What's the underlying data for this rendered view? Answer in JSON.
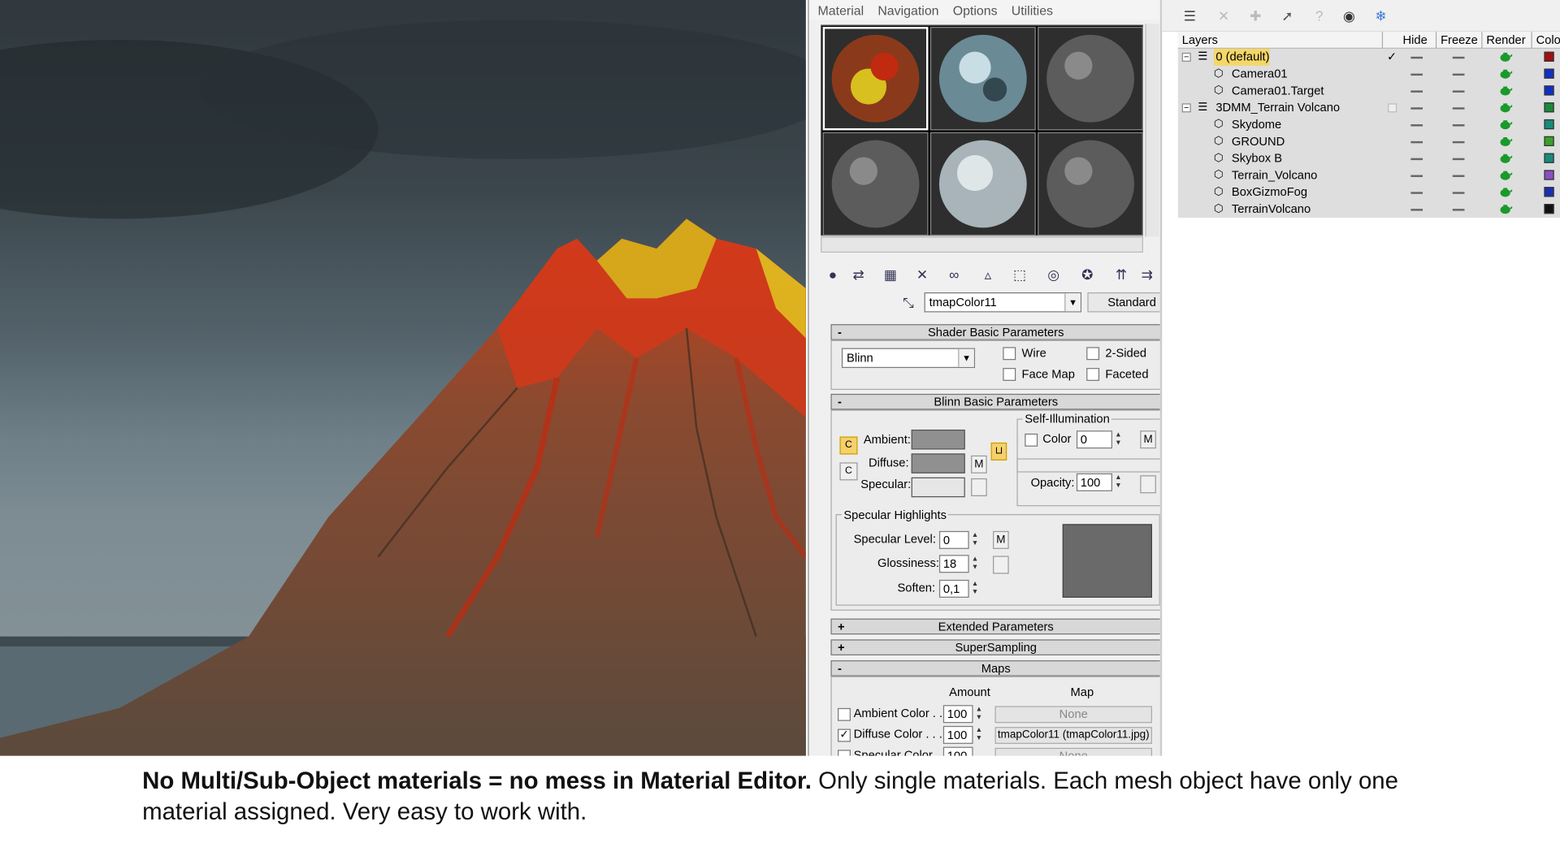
{
  "menu": [
    "Material",
    "Navigation",
    "Options",
    "Utilities"
  ],
  "material_name": "tmapColor11",
  "material_type": "Standard",
  "rollouts": {
    "shader_basic": "Shader Basic Parameters",
    "blinn_basic": "Blinn Basic Parameters",
    "extended": "Extended Parameters",
    "supersampling": "SuperSampling",
    "maps": "Maps"
  },
  "shader": {
    "value": "Blinn",
    "wire": "Wire",
    "two_sided": "2-Sided",
    "face_map": "Face Map",
    "faceted": "Faceted"
  },
  "blinn": {
    "ambient": "Ambient:",
    "diffuse": "Diffuse:",
    "specular": "Specular:",
    "self_illum_title": "Self-Illumination",
    "color": "Color",
    "color_value": "0",
    "opacity": "Opacity:",
    "opacity_value": "100",
    "m": "M"
  },
  "highlights": {
    "title": "Specular Highlights",
    "level_label": "Specular Level:",
    "level": "0",
    "gloss_label": "Glossiness:",
    "gloss": "18",
    "soften_label": "Soften:",
    "soften": "0,1"
  },
  "maps": {
    "amount": "Amount",
    "map": "Map",
    "rows": [
      {
        "label": "Ambient Color . . .",
        "amount": "100",
        "map": "None",
        "checked": false
      },
      {
        "label": "Diffuse Color . . . .",
        "amount": "100",
        "map": "tmapColor11 (tmapColor11.jpg)",
        "checked": true
      },
      {
        "label": "Specular Color . .",
        "amount": "100",
        "map": "None",
        "checked": false
      }
    ]
  },
  "layers": {
    "headers": [
      "Layers",
      "Hide",
      "Freeze",
      "Render",
      "Color"
    ],
    "rows": [
      {
        "name": "0 (default)",
        "level": 0,
        "group": true,
        "color": "#a01010",
        "selected": true
      },
      {
        "name": "Camera01",
        "level": 1,
        "group": false,
        "color": "#1030c0"
      },
      {
        "name": "Camera01.Target",
        "level": 1,
        "group": false,
        "color": "#1030c0"
      },
      {
        "name": "3DMM_Terrain Volcano",
        "level": 0,
        "group": true,
        "color": "#1a8a3a"
      },
      {
        "name": "Skydome",
        "level": 1,
        "group": false,
        "color": "#1a8a7a"
      },
      {
        "name": "GROUND",
        "level": 1,
        "group": false,
        "color": "#3aa02a"
      },
      {
        "name": "Skybox B",
        "level": 1,
        "group": false,
        "color": "#1a8a7a"
      },
      {
        "name": "Terrain_Volcano",
        "level": 1,
        "group": false,
        "color": "#8a50c0"
      },
      {
        "name": "BoxGizmoFog",
        "level": 1,
        "group": false,
        "color": "#1a30b0"
      },
      {
        "name": "TerrainVolcano",
        "level": 1,
        "group": false,
        "color": "#111111"
      }
    ]
  },
  "caption": {
    "bold": "No Multi/Sub-Object materials = no mess in Material Editor.",
    "rest": " Only single materials. Each mesh object have only one material assigned. Very easy to work with."
  }
}
